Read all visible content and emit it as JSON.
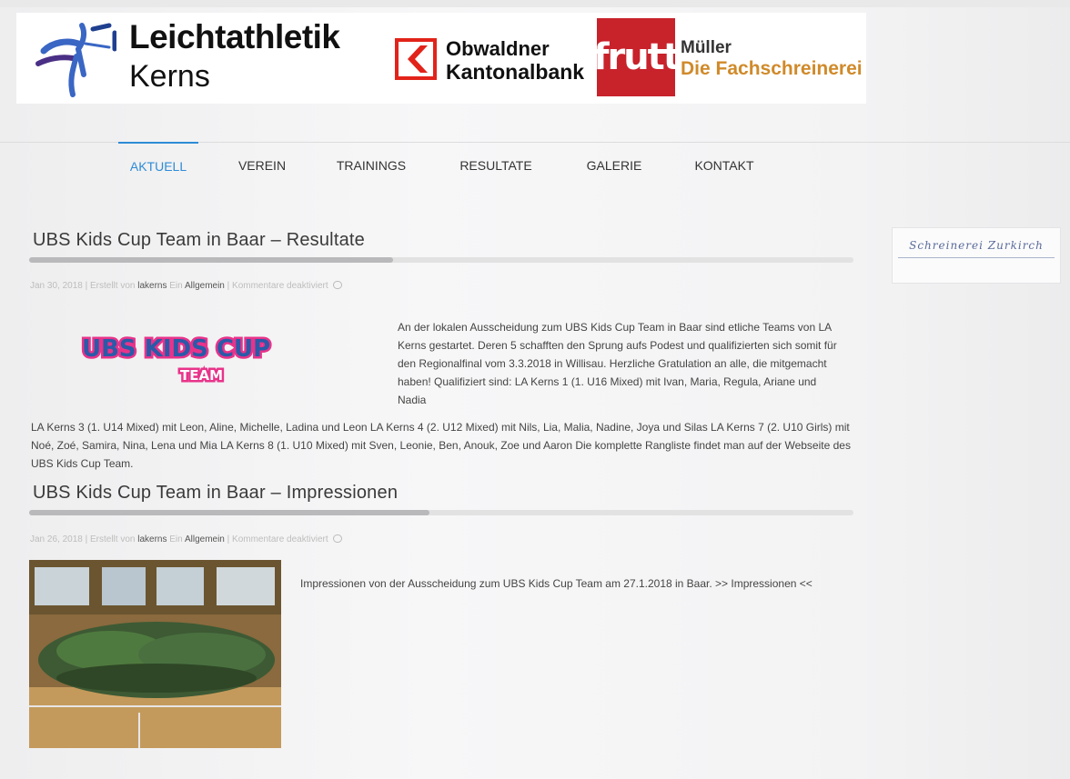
{
  "header": {
    "title_line1": "Leichtathletik",
    "title_line2": "Kerns",
    "sponsors": {
      "okb_line1": "Obwaldner",
      "okb_line2": "Kantonalbank",
      "frutt": "frutt",
      "mueller_line1": "Müller",
      "mueller_line2": "Die Fachschreinerei"
    }
  },
  "nav": {
    "items": [
      {
        "label": "AKTUELL"
      },
      {
        "label": "VEREIN"
      },
      {
        "label": "TRAININGS"
      },
      {
        "label": "RESULTATE"
      },
      {
        "label": "GALERIE"
      },
      {
        "label": "KONTAKT"
      }
    ],
    "active": "AKTUELL"
  },
  "posts": [
    {
      "title": "UBS Kids Cup Team in Baar – Resultate",
      "meta": {
        "date": "Jan 30, 2018",
        "created_by_label": "| Erstellt von",
        "author": "lakerns",
        "in_label": "Ein",
        "category": "Allgemein",
        "comments": "| Kommentare deaktiviert"
      },
      "logo_text": "UBS KIDS CUP",
      "logo_sub": "TEAM",
      "text_right": "An der lokalen Ausscheidung zum UBS Kids Cup Team in Baar sind etliche Teams von LA Kerns gestartet. Deren 5 schafften den Sprung aufs Podest und qualifizierten sich somit für den Regionalfinal vom 3.3.2018 in Willisau. Herzliche Gratulation an alle, die mitgemacht haben!   Qualifiziert sind: LA Kerns 1 (1. U16 Mixed) mit Ivan, Maria, Regula, Ariane und Nadia",
      "text_full": "LA Kerns 3 (1. U14 Mixed) mit Leon, Aline, Michelle, Ladina und Leon LA Kerns 4 (2. U12 Mixed) mit Nils, Lia, Malia, Nadine, Joya und Silas LA Kerns 7 (2. U10 Girls) mit Noé, Zoé, Samira, Nina, Lena und Mia LA Kerns 8 (1. U10 Mixed) mit Sven, Leonie, Ben, Anouk, Zoe und Aaron                  Die komplette Rangliste findet man auf der Webseite des UBS Kids Cup Team."
    },
    {
      "title": "UBS Kids Cup Team in Baar – Impressionen",
      "meta": {
        "date": "Jan 26, 2018",
        "created_by_label": "| Erstellt von",
        "author": "lakerns",
        "in_label": "Ein",
        "category": "Allgemein",
        "comments": "| Kommentare deaktiviert"
      },
      "text": "Impressionen von der Ausscheidung zum UBS Kids Cup Team am 27.1.2018 in Baar. >> Impressionen <<"
    }
  ],
  "sidebar": {
    "widget_text": "Schreinerei Zurkirch"
  },
  "colors": {
    "accent": "#2e8bd6",
    "frutt_red": "#c8222b",
    "okb_red": "#e2231a",
    "mueller_orange": "#d08a2a",
    "kids_pink": "#e8338a",
    "kids_blue": "#2a5aa8"
  }
}
